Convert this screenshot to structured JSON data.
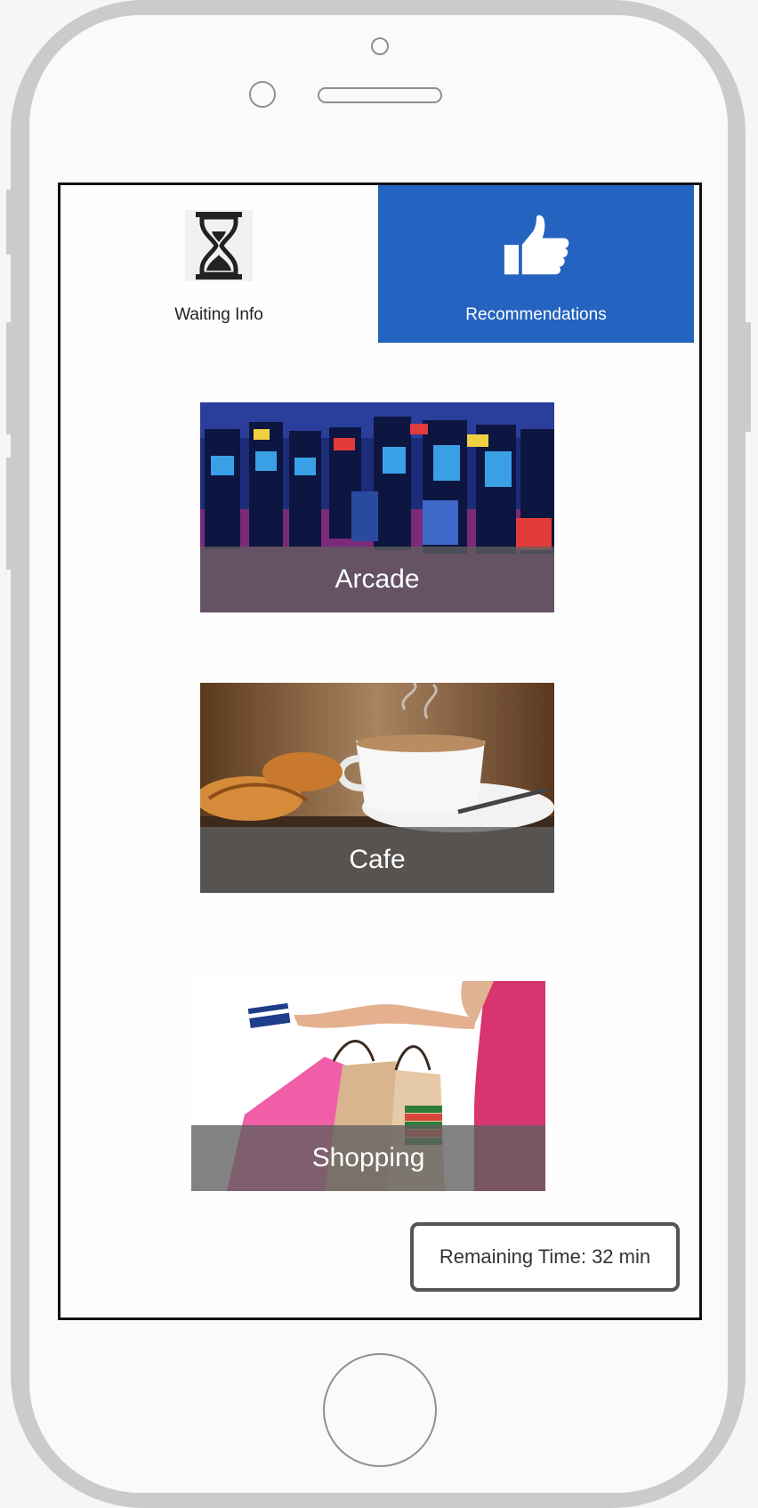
{
  "tabs": [
    {
      "label": "Waiting Info",
      "icon": "hourglass-icon",
      "selected": false
    },
    {
      "label": "Recommendations",
      "icon": "thumbs-up-icon",
      "selected": true
    }
  ],
  "recommendations": [
    {
      "label": "Arcade",
      "image": "arcade-photo"
    },
    {
      "label": "Cafe",
      "image": "cafe-photo"
    },
    {
      "label": "Shopping",
      "image": "shopping-photo"
    }
  ],
  "tooltip": {
    "text": "Remaining Time: 32 min"
  },
  "colors": {
    "accent": "#2463bf",
    "caption_band": "#5f5f5f",
    "device_frame": "#cbcbcb"
  }
}
